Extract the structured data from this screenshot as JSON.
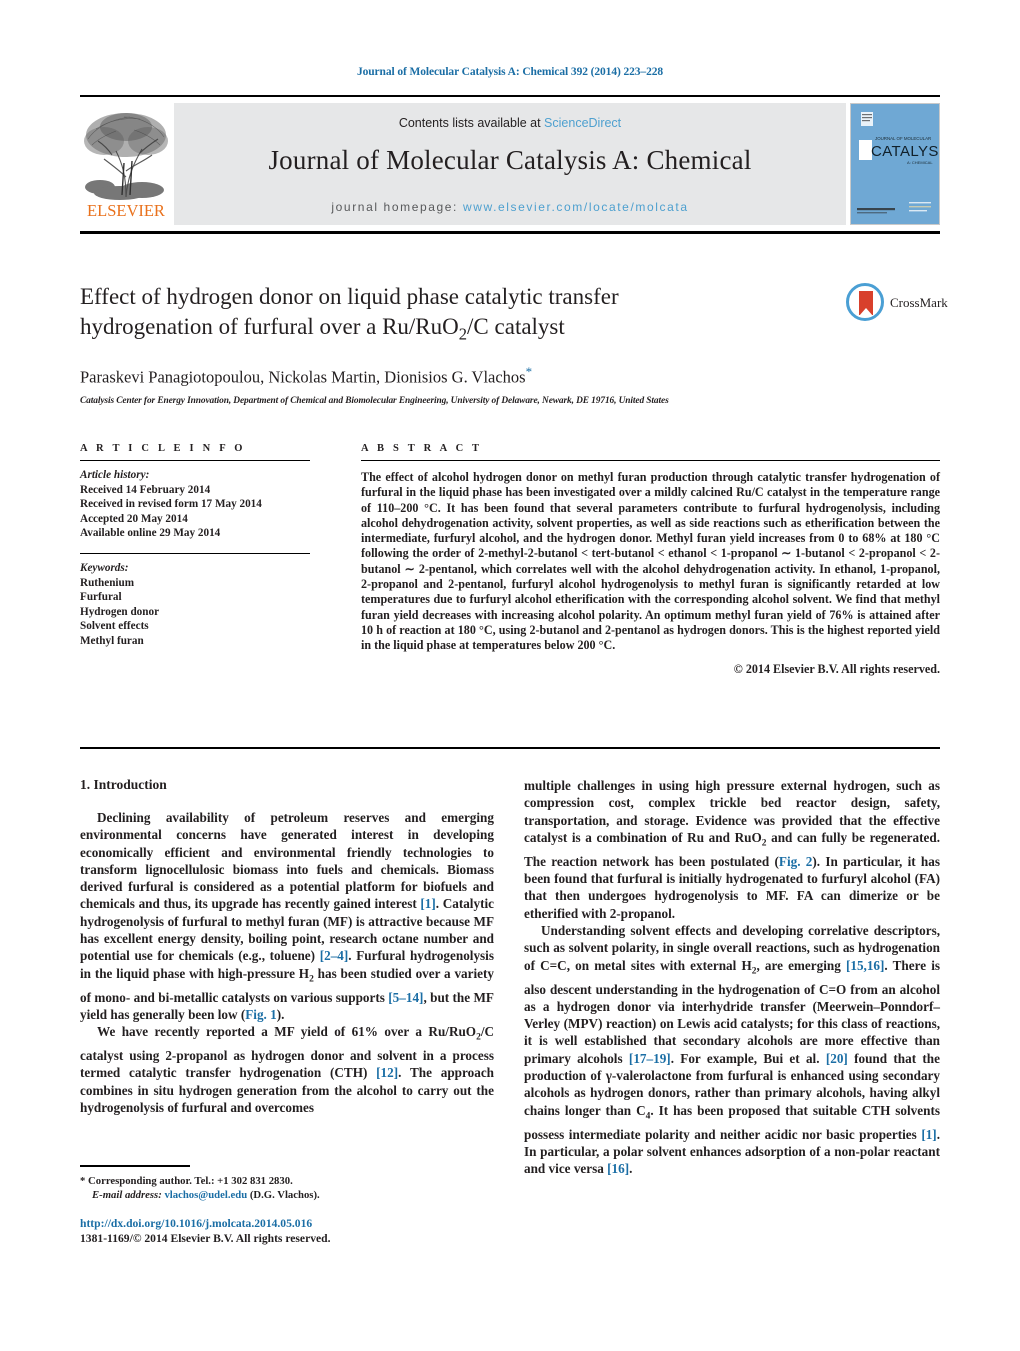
{
  "running_head": "Journal of Molecular Catalysis A: Chemical 392 (2014) 223–228",
  "masthead": {
    "contents_prefix": "Contents lists available at ",
    "contents_link": "ScienceDirect",
    "journal_title": "Journal of Molecular Catalysis A: Chemical",
    "homepage_prefix": "journal homepage: ",
    "homepage_url": "www.elsevier.com/locate/molcata",
    "publisher": "ELSEVIER",
    "cover_caption_1": "JOURNAL OF MOLECULAR",
    "cover_caption_2": "CATALYSIS",
    "cover_caption_3": "A: CHEMICAL"
  },
  "title": {
    "line1": "Effect of hydrogen donor on liquid phase catalytic transfer",
    "line2_a": "hydrogenation of furfural over a Ru/RuO",
    "line2_sub": "2",
    "line2_b": "/C catalyst",
    "authors": "Paraskevi Panagiotopoulou, Nickolas Martin, Dionisios G. Vlachos",
    "corresponding_marker": "*",
    "affiliation": "Catalysis Center for Energy Innovation, Department of Chemical and Biomolecular Engineering, University of Delaware, Newark, DE 19716, United States"
  },
  "crossmark": {
    "label": "CrossMark"
  },
  "article_info": {
    "heading": "A R T I C L E   I N F O",
    "history_label": "Article history:",
    "history": [
      "Received 14 February 2014",
      "Received in revised form 17 May 2014",
      "Accepted 20 May 2014",
      "Available online 29 May 2014"
    ],
    "keywords_label": "Keywords:",
    "keywords": [
      "Ruthenium",
      "Furfural",
      "Hydrogen donor",
      "Solvent effects",
      "Methyl furan"
    ]
  },
  "abstract": {
    "heading": "A B S T R A C T",
    "text": "The effect of alcohol hydrogen donor on methyl furan production through catalytic transfer hydrogenation of furfural in the liquid phase has been investigated over a mildly calcined Ru/C catalyst in the temperature range of 110–200 °C. It has been found that several parameters contribute to furfural hydrogenolysis, including alcohol dehydrogenation activity, solvent properties, as well as side reactions such as etherification between the intermediate, furfuryl alcohol, and the hydrogen donor. Methyl furan yield increases from 0 to 68% at 180 °C following the order of 2-methyl-2-butanol < tert-butanol < ethanol < 1-propanol ∼ 1-butanol < 2-propanol < 2-butanol ∼ 2-pentanol, which correlates well with the alcohol dehydrogenation activity. In ethanol, 1-propanol, 2-propanol and 2-pentanol, furfuryl alcohol hydrogenolysis to methyl furan is significantly retarded at low temperatures due to furfuryl alcohol etherification with the corresponding alcohol solvent. We find that methyl furan yield decreases with increasing alcohol polarity. An optimum methyl furan yield of 76% is attained after 10 h of reaction at 180 °C, using 2-butanol and 2-pentanol as hydrogen donors. This is the highest reported yield in the liquid phase at temperatures below 200 °C.",
    "copyright": "© 2014 Elsevier B.V. All rights reserved."
  },
  "introduction": {
    "heading": "1.  Introduction",
    "left_p1_a": "Declining availability of petroleum reserves and emerging environmental concerns have generated interest in developing economically efficient and environmental friendly technologies to transform lignocellulosic biomass into fuels and chemicals. Biomass derived furfural is considered as a potential platform for biofuels and chemicals and thus, its upgrade has recently gained interest ",
    "left_p1_ref1": "[1]",
    "left_p1_b": ". Catalytic hydrogenolysis of furfural to methyl furan (MF) is attractive because MF has excellent energy density, boiling point, research octane number and potential use for chemicals (e.g., toluene) ",
    "left_p1_ref2": "[2–4]",
    "left_p1_c": ". Furfural hydrogenolysis in the liquid phase with high-pressure H",
    "left_p1_sub": "2",
    "left_p1_d": " has been studied over a variety of mono- and bi-metallic catalysts on various supports ",
    "left_p1_ref3": "[5–14]",
    "left_p1_e": ", but the MF yield has generally been low (",
    "left_p1_fig": "Fig. 1",
    "left_p1_f": ").",
    "left_p2_a": "We have recently reported a MF yield of 61% over a Ru/RuO",
    "left_p2_sub": "2",
    "left_p2_b": "/C catalyst using 2-propanol as hydrogen donor and solvent in a process termed catalytic transfer hydrogenation (CTH) ",
    "left_p2_ref": "[12]",
    "left_p2_c": ". The approach combines in situ hydrogen generation from the alcohol to carry out the hydrogenolysis of furfural and overcomes",
    "right_p1_a": "multiple challenges in using high pressure external hydrogen, such as compression cost, complex trickle bed reactor design, safety, transportation, and storage. Evidence was provided that the effective catalyst is a combination of Ru and RuO",
    "right_p1_sub": "2",
    "right_p1_b": " and can fully be regenerated. The reaction network has been postulated (",
    "right_p1_fig": "Fig. 2",
    "right_p1_c": "). In particular, it has been found that furfural is initially hydrogenated to furfuryl alcohol (FA) that then undergoes hydrogenolysis to MF. FA can dimerize or be etherified with 2-propanol.",
    "right_p2_a": "Understanding solvent effects and developing correlative descriptors, such as solvent polarity, in single overall reactions, such as hydrogenation of C",
    "right_p2_bond1": "=",
    "right_p2_b": "C, on metal sites with external H",
    "right_p2_sub1": "2",
    "right_p2_c": ", are emerging ",
    "right_p2_ref1": "[15,16]",
    "right_p2_d": ". There is also descent understanding in the hydrogenation of C",
    "right_p2_bond2": "=",
    "right_p2_e": "O from an alcohol as a hydrogen donor via interhydride transfer (Meerwein–Ponndorf–Verley (MPV) reaction) on Lewis acid catalysts; for this class of reactions, it is well established that secondary alcohols are more effective than primary alcohols ",
    "right_p2_ref2": "[17–19]",
    "right_p2_f": ". For example, Bui et al. ",
    "right_p2_ref3": "[20]",
    "right_p2_g": " found that the production of γ-valerolactone from furfural is enhanced using secondary alcohols as hydrogen donors, rather than primary alcohols, having alkyl chains longer than C",
    "right_p2_sub2": "4",
    "right_p2_h": ". It has been proposed that suitable CTH solvents possess intermediate polarity and neither acidic nor basic properties ",
    "right_p2_ref4": "[1]",
    "right_p2_i": ". In particular, a polar solvent enhances adsorption of a non-polar reactant and vice versa ",
    "right_p2_ref5": "[16]",
    "right_p2_j": "."
  },
  "footnote": {
    "marker": "*",
    "corresponding": " Corresponding author. Tel.: +1 302 831 2830.",
    "email_label": "E-mail address:",
    "email": "vlachos@udel.edu",
    "email_suffix": " (D.G. Vlachos)."
  },
  "doi": {
    "url": "http://dx.doi.org/10.1016/j.molcata.2014.05.016",
    "issn_line": "1381-1169/© 2014 Elsevier B.V. All rights reserved."
  },
  "colors": {
    "link_blue": "#1b6ea5",
    "sciencedirect_blue": "#4ea0cf",
    "elsevier_orange": "#E9711C",
    "masthead_gray": "#e6e7e8",
    "crossmark_blue": "#4a9fd4",
    "crossmark_red": "#d8402c",
    "cover_blue": "#6fa8d4"
  }
}
